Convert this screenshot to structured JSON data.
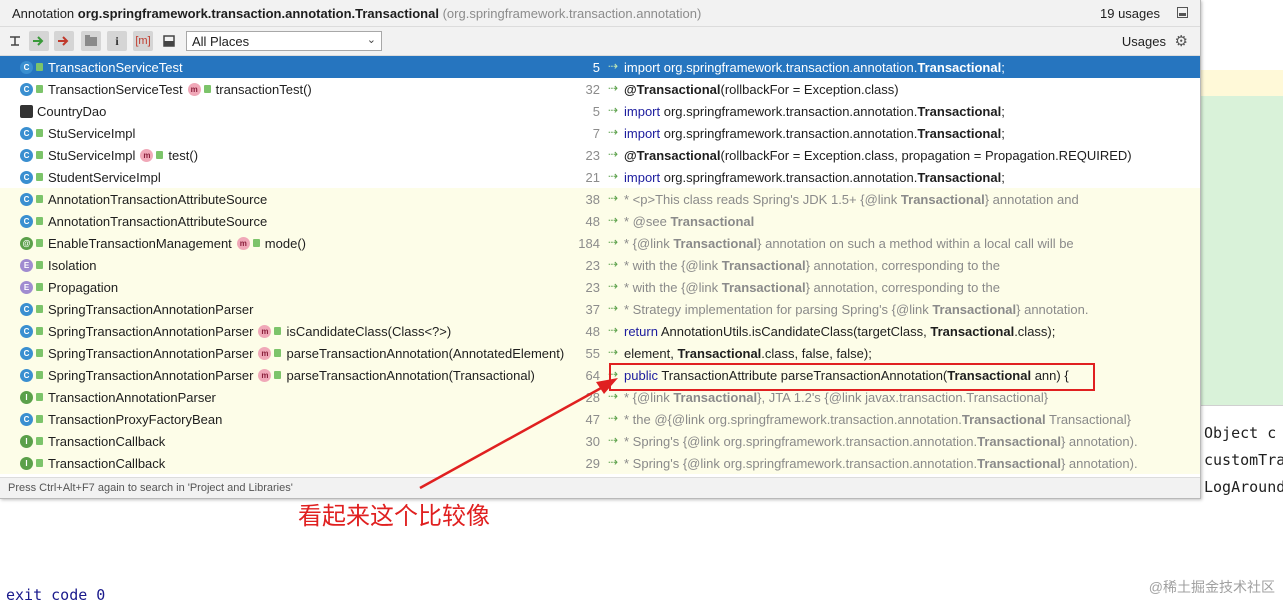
{
  "popup": {
    "title_prefix": "Annotation ",
    "title_class": "org.springframework.transaction.annotation.Transactional",
    "title_package": "(org.springframework.transaction.annotation)",
    "usages_count": "19 usages"
  },
  "toolbar": {
    "scope_value": "All Places",
    "usages_label": "Usages"
  },
  "rows": [
    {
      "cls": "TransactionServiceTest",
      "icon": "class",
      "method": "",
      "line": "5",
      "code_kw": "import ",
      "code_a": "org.springframework.transaction.annotation.",
      "code_b": "Transactional",
      "code_c": ";"
    },
    {
      "cls": "TransactionServiceTest",
      "icon": "class",
      "method": "transactionTest()",
      "line": "32",
      "code_kw": "",
      "code_a": "",
      "code_b": "@Transactional",
      "code_c": "(rollbackFor = Exception.class)"
    },
    {
      "cls": "CountryDao",
      "icon": "dao",
      "method": "",
      "line": "5",
      "code_kw": "import ",
      "code_a": "org.springframework.transaction.annotation.",
      "code_b": "Transactional",
      "code_c": ";"
    },
    {
      "cls": "StuServiceImpl",
      "icon": "class",
      "method": "",
      "line": "7",
      "code_kw": "import ",
      "code_a": "org.springframework.transaction.annotation.",
      "code_b": "Transactional",
      "code_c": ";"
    },
    {
      "cls": "StuServiceImpl",
      "icon": "class",
      "method": "test()",
      "line": "23",
      "code_kw": "",
      "code_a": "",
      "code_b": "@Transactional",
      "code_c": "(rollbackFor = Exception.class, propagation = Propagation.REQUIRED)"
    },
    {
      "cls": "StudentServiceImpl",
      "icon": "class",
      "method": "",
      "line": "21",
      "code_kw": "import ",
      "code_a": "org.springframework.transaction.annotation.",
      "code_b": "Transactional",
      "code_c": ";"
    },
    {
      "cls": "AnnotationTransactionAttributeSource",
      "icon": "class",
      "method": "",
      "line": "38",
      "code_kw": "",
      "code_a": "* <p>This class reads Spring's JDK 1.5+ {@link ",
      "code_b": "Transactional",
      "code_c": "} annotation and"
    },
    {
      "cls": "AnnotationTransactionAttributeSource",
      "icon": "class",
      "method": "",
      "line": "48",
      "code_kw": "",
      "code_a": "* @see ",
      "code_b": "Transactional",
      "code_c": ""
    },
    {
      "cls": "EnableTransactionManagement",
      "icon": "annotation",
      "method": "mode()",
      "line": "184",
      "code_kw": "",
      "code_a": "* {@link ",
      "code_b": "Transactional",
      "code_c": "} annotation on such a method within a local call will be"
    },
    {
      "cls": "Isolation",
      "icon": "enum",
      "method": "",
      "line": "23",
      "code_kw": "",
      "code_a": "* with the {@link ",
      "code_b": "Transactional",
      "code_c": "} annotation, corresponding to the"
    },
    {
      "cls": "Propagation",
      "icon": "enum",
      "method": "",
      "line": "23",
      "code_kw": "",
      "code_a": "* with the {@link ",
      "code_b": "Transactional",
      "code_c": "} annotation, corresponding to the"
    },
    {
      "cls": "SpringTransactionAnnotationParser",
      "icon": "class",
      "method": "",
      "line": "37",
      "code_kw": "",
      "code_a": "* Strategy implementation for parsing Spring's {@link ",
      "code_b": "Transactional",
      "code_c": "} annotation."
    },
    {
      "cls": "SpringTransactionAnnotationParser",
      "icon": "class",
      "method": "isCandidateClass(Class<?>)",
      "line": "48",
      "code_kw": "return ",
      "code_a": "AnnotationUtils.isCandidateClass(targetClass, ",
      "code_b": "Transactional",
      "code_c": ".class);"
    },
    {
      "cls": "SpringTransactionAnnotationParser",
      "icon": "class",
      "method": "parseTransactionAnnotation(AnnotatedElement)",
      "line": "55",
      "code_kw": "",
      "code_a": "element, ",
      "code_b": "Transactional",
      "code_c": ".class, false, false);"
    },
    {
      "cls": "SpringTransactionAnnotationParser",
      "icon": "class",
      "method": "parseTransactionAnnotation(Transactional)",
      "line": "64",
      "code_kw": "public ",
      "code_a": "TransactionAttribute parseTransactionAnnotation(",
      "code_b": "Transactional",
      "code_c": " ann) {"
    },
    {
      "cls": "TransactionAnnotationParser",
      "icon": "interface",
      "method": "",
      "line": "28",
      "code_kw": "",
      "code_a": "* {@link ",
      "code_b": "Transactional",
      "code_c": "}, JTA 1.2's {@link javax.transaction.Transactional}"
    },
    {
      "cls": "TransactionProxyFactoryBean",
      "icon": "class",
      "method": "",
      "line": "47",
      "code_kw": "",
      "code_a": "* the @{@link org.springframework.transaction.annotation.",
      "code_b": "Transactional",
      "code_c": " Transactional}"
    },
    {
      "cls": "TransactionCallback",
      "icon": "interface",
      "method": "",
      "line": "30",
      "code_kw": "",
      "code_a": "* Spring's {@link org.springframework.transaction.annotation.",
      "code_b": "Transactional",
      "code_c": "} annotation)."
    },
    {
      "cls": "TransactionCallback",
      "icon": "interface",
      "method": "",
      "line": "29",
      "code_kw": "",
      "code_a": "* Spring's {@link org.springframework.transaction.annotation.",
      "code_b": "Transactional",
      "code_c": "} annotation)."
    }
  ],
  "status_hint": "Press Ctrl+Alt+F7 again to search in 'Project and Libraries'",
  "annotation_text": "看起来这个比较像",
  "console": {
    "line1": "Object c",
    "line2": "customTra",
    "line3": "LogAround",
    "exit": "exit code 0"
  },
  "watermark": "@稀土掘金技术社区",
  "colors": {
    "selection": "#2675bf",
    "highlight": "#e02020",
    "yellow_row": "#fdfde8"
  }
}
